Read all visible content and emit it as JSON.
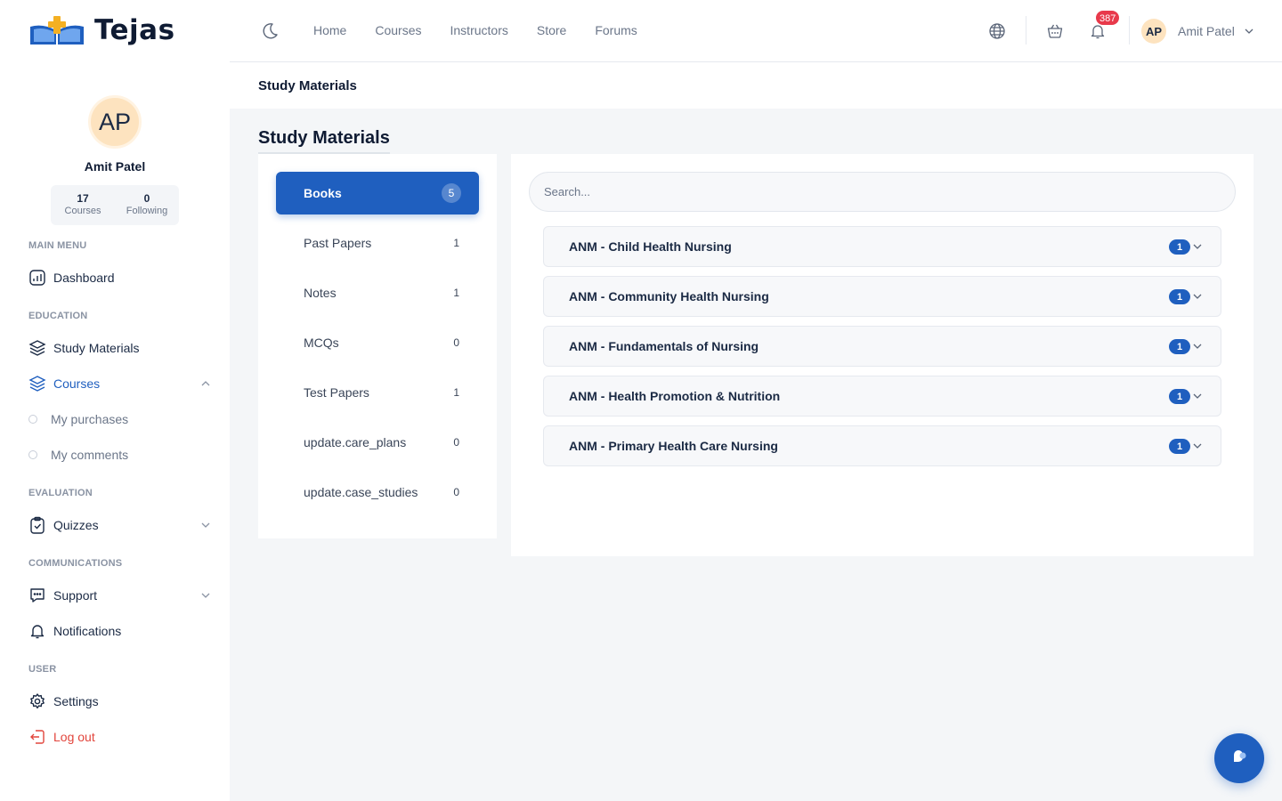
{
  "brand": {
    "name": "Tejas"
  },
  "profile": {
    "initials": "AP",
    "name": "Amit Patel",
    "courses_count": "17",
    "courses_label": "Courses",
    "following_count": "0",
    "following_label": "Following"
  },
  "sidebar": {
    "sections": [
      "MAIN MENU",
      "EDUCATION",
      "EVALUATION",
      "COMMUNICATIONS",
      "USER"
    ],
    "items": [
      {
        "label": "Dashboard",
        "icon": "dashboard-icon"
      },
      {
        "label": "Study Materials",
        "icon": "layers-icon"
      },
      {
        "label": "Courses",
        "icon": "layers-icon",
        "active": true,
        "expanded": true
      },
      {
        "label": "My purchases"
      },
      {
        "label": "My comments"
      },
      {
        "label": "Quizzes",
        "icon": "clipboard-icon"
      },
      {
        "label": "Support",
        "icon": "chat-icon"
      },
      {
        "label": "Notifications",
        "icon": "bell-icon"
      },
      {
        "label": "Settings",
        "icon": "gear-icon"
      },
      {
        "label": "Log out",
        "icon": "logout-icon"
      }
    ]
  },
  "header": {
    "nav": [
      "Home",
      "Courses",
      "Instructors",
      "Store",
      "Forums"
    ],
    "notification_count": "387",
    "user_initials": "AP",
    "user_name": "Amit Patel"
  },
  "breadcrumb": "Study Materials",
  "page_title": "Study Materials",
  "categories": [
    {
      "label": "Books",
      "count": "5",
      "active": true
    },
    {
      "label": "Past Papers",
      "count": "1"
    },
    {
      "label": "Notes",
      "count": "1"
    },
    {
      "label": "MCQs",
      "count": "0"
    },
    {
      "label": "Test Papers",
      "count": "1"
    },
    {
      "label": "update.care_plans",
      "count": "0"
    },
    {
      "label": "update.case_studies",
      "count": "0"
    }
  ],
  "search": {
    "placeholder": "Search..."
  },
  "materials": [
    {
      "title": "ANM - Child Health Nursing",
      "count": "1"
    },
    {
      "title": "ANM - Community Health Nursing",
      "count": "1"
    },
    {
      "title": "ANM - Fundamentals of Nursing",
      "count": "1"
    },
    {
      "title": "ANM - Health Promotion & Nutrition",
      "count": "1"
    },
    {
      "title": "ANM - Primary Health Care Nursing",
      "count": "1"
    }
  ],
  "colors": {
    "accent": "#1f5fbf",
    "danger": "#e2453c",
    "badge": "#e8394b",
    "avatar_bg": "#fde3bf"
  }
}
